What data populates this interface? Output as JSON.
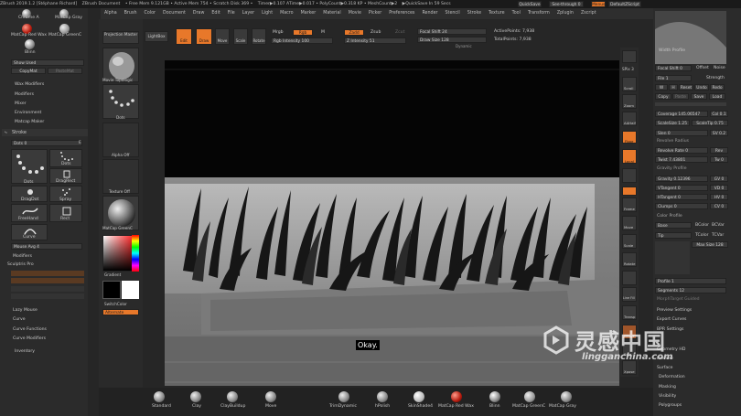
{
  "titlebar": {
    "app": "ZBrush 2019.1.2 [Stéphane Richard]",
    "doc": "ZBrush Document",
    "mem": "• Free Mem 9.121GB • Active Mem 754 • Scratch Disk 369 •",
    "timer": "Timer▶0.107 ATime▶0.017 • PolyCount▶0.318 KP • MeshCount▶2",
    "autosave": "▶QuickSave In 59 Secs",
    "quicksave": "QuickSave",
    "seethrough": "See-through 0",
    "menus": "Menus",
    "script": "DefaultZScript"
  },
  "menus": [
    "Alpha",
    "Brush",
    "Color",
    "Document",
    "Draw",
    "Edit",
    "File",
    "Layer",
    "Light",
    "Macro",
    "Marker",
    "Material",
    "Movie",
    "Picker",
    "Preferences",
    "Render",
    "Stencil",
    "Stroke",
    "Texture",
    "Tool",
    "Transform",
    "Zplugin",
    "Zscript"
  ],
  "left": {
    "mat1": "Chrome A",
    "mat2": "MatCap Gray",
    "mat3": "MatCap Red Wax",
    "mat4": "MatCap GreenC",
    "mat5": "Blinn",
    "show_used": "Show Used",
    "copy_mat": "CopyMat",
    "paste_mat": "PasteMat",
    "sections": [
      "Wax Modifiers",
      "Modifiers",
      "Mixer",
      "Environment",
      "Matcap Maker"
    ],
    "stroke_title": "Stroke",
    "dots_label": "Dots 0",
    "dots_e": "E",
    "stroke_types": [
      "Dots",
      "Dots",
      "DragRect",
      "DragDot",
      "Spray",
      "FreeHand",
      "Rect",
      "Curve"
    ],
    "mouse_avg": "Mouse Avg 4",
    "modifiers": "Modifiers",
    "sculptris": "Sculptris Pro",
    "lazy": [
      "Lazy Mouse",
      "Curve",
      "Curve Functions",
      "Curve Modifiers"
    ],
    "inventory": "Inventory"
  },
  "tool_col": {
    "projection": "Projection Master",
    "lightbox": "LightBox",
    "movie_topo": "Movie Topologic",
    "dots": "Dots",
    "alpha_off": "Alpha Off",
    "texture_off": "Texture Off",
    "matcap": "MatCap GreenC",
    "gradient": "Gradient",
    "switch_color": "SwitchColor",
    "alternate": "Alternate"
  },
  "topbar": {
    "edit": "Edit",
    "draw": "Draw",
    "move": "Move",
    "scale": "Scale",
    "rotate": "Rotate",
    "mrgb": "Mrgb",
    "rgb": "Rgb",
    "m": "M",
    "rgb_intensity": "Rgb Intensity 100",
    "zadd": "Zadd",
    "zsub": "Zsub",
    "zcut": "Zcut",
    "z_intensity": "Z Intensity 51",
    "focal_shift": "Focal Shift 24",
    "draw_size": "Draw Size 128",
    "active_points": "ActivePoints: 7,938",
    "total_points": "TotalPoints: 7,938",
    "dynamic": "Dynamic"
  },
  "canvas": {
    "subtitle": "Okay."
  },
  "right_icons": [
    "SPix 3",
    "Scroll",
    "Zoom",
    "Actual",
    "AAHalf",
    "Persp",
    "Floor",
    "Local",
    "Frame",
    "Move",
    "Scale",
    "Rotate",
    "Line Fill",
    "Transp",
    "Ghost",
    "Solo",
    "Xpose"
  ],
  "right": {
    "width_profile": "Width Profile",
    "focal_shift": "Focal Shift 0",
    "offset": "Offset",
    "noise": "Noise",
    "file": "File 1",
    "strength": "Strength",
    "buttons1": [
      "W",
      "H",
      "Reset",
      "Undo",
      "Redo"
    ],
    "copy": "Copy",
    "paste": "Paste",
    "save": "Save",
    "load": "Load",
    "coverage": "Coverage 145.06547",
    "col": "Col 0.1",
    "scalesize": "ScaleSize 1.25",
    "scaletip": "ScaleTip 0.75",
    "slen": "Slen 0",
    "sv": "SV 0.2",
    "revolve_title": "Revolve Radius",
    "revolve_rate": "Revolve Rate 0",
    "rev": "Rev",
    "twist": "Twist 7.43801",
    "tw": "Tw 0",
    "gravity_title": "Gravity Profile",
    "gravity": "Gravity 0.12396",
    "gv": "GV 0",
    "vtangent": "VTangent 0",
    "vd": "VD 0",
    "htangent": "HTangent 0",
    "hv": "HV 0",
    "clumps": "Clumps 0",
    "cv": "CV 0",
    "color_profile": "Color Profile",
    "base": "Base",
    "bcolor": "BColor",
    "bcvar": "BCVar",
    "tip": "Tip",
    "tcolor": "TColor",
    "tcvar": "TCVar",
    "max_size": "Max Size 128",
    "profile": "Profile 1",
    "segments": "Segments 12",
    "morph": "MorphTarget Guided",
    "preview_settings": "Preview Settings",
    "export_curves": "Export Curves",
    "bpr": "BPR Settings",
    "geometry_hd": "Geometry HD",
    "preview": "Preview",
    "surface": "Surface",
    "deformation": "Deformation",
    "masking": "Masking",
    "visibility": "Visibility",
    "polygroups": "Polygroups"
  },
  "bottom_materials": [
    "Standard",
    "Clay",
    "ClayBuildup",
    "Move",
    "TrimDynamic",
    "hPolish",
    "SkinShade4",
    "MatCap Red Wax",
    "Blinn",
    "MatCap GreenC",
    "MatCap Gray"
  ],
  "watermark": {
    "cn": "灵感中国",
    "url": "lingganchina.com"
  },
  "colors": {
    "accent": "#e8782a",
    "background": "#262626",
    "canvas": "#0a0a0a"
  }
}
